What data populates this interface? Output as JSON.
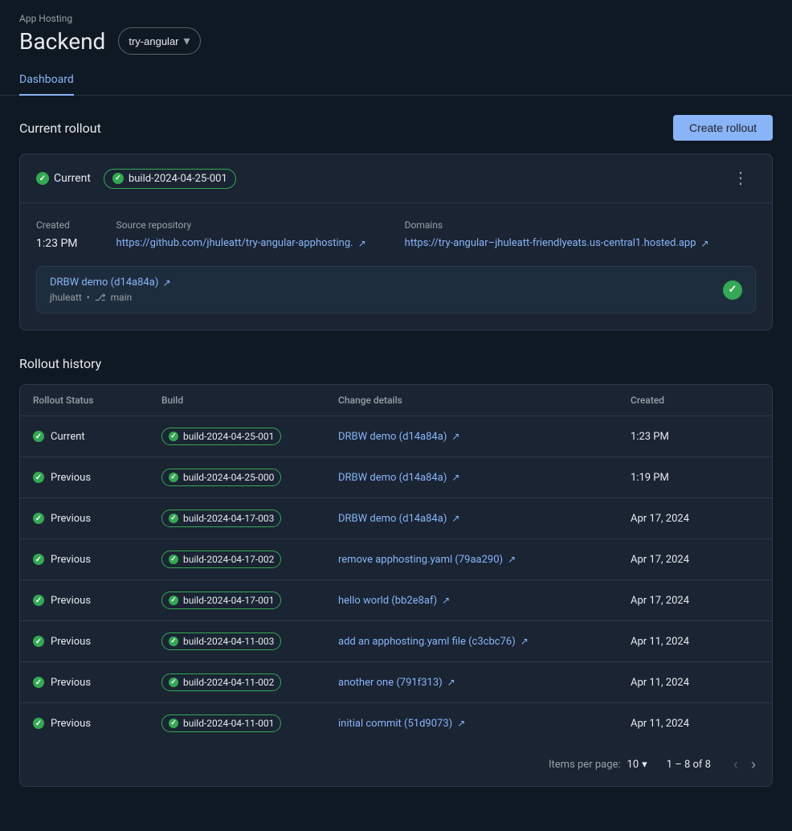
{
  "header": {
    "app_hosting_label": "App Hosting",
    "backend_title": "Backend",
    "branch_selector": {
      "value": "try-angular",
      "icon": "chevron-down"
    },
    "tabs": [
      {
        "id": "dashboard",
        "label": "Dashboard",
        "active": true
      }
    ]
  },
  "current_rollout": {
    "section_title": "Current rollout",
    "create_button_label": "Create rollout",
    "status": "Current",
    "build_id": "build-2024-04-25-001",
    "more_icon": "⋮",
    "created_label": "Created",
    "created_value": "1:23 PM",
    "source_repo_label": "Source repository",
    "source_repo_url": "https://github.com/jhuleatt/try-angular-apphosting",
    "source_repo_display": "https://github.com/jhuleatt/try-angular-apphosting.",
    "domains_label": "Domains",
    "domains_url": "https://try-angular–jhuleatt-friendlyeats.us-central1.hosted.app",
    "domains_display": "https://try-angular–jhuleatt-friendlyeats.us-central1.hosted.app",
    "commit": {
      "title": "DRBW demo (d14a84a)",
      "link": "https://github.com/jhuleatt/try-angular-apphosting/commit/d14a84a",
      "author": "jhuleatt",
      "branch": "main"
    }
  },
  "rollout_history": {
    "section_title": "Rollout history",
    "table": {
      "columns": [
        "Rollout Status",
        "Build",
        "Change details",
        "Created"
      ],
      "rows": [
        {
          "status": "Current",
          "build": "build-2024-04-25-001",
          "change": "DRBW demo (d14a84a)",
          "change_url": "#",
          "created": "1:23 PM"
        },
        {
          "status": "Previous",
          "build": "build-2024-04-25-000",
          "change": "DRBW demo (d14a84a)",
          "change_url": "#",
          "created": "1:19 PM"
        },
        {
          "status": "Previous",
          "build": "build-2024-04-17-003",
          "change": "DRBW demo (d14a84a)",
          "change_url": "#",
          "created": "Apr 17, 2024"
        },
        {
          "status": "Previous",
          "build": "build-2024-04-17-002",
          "change": "remove apphosting.yaml (79aa290)",
          "change_url": "#",
          "created": "Apr 17, 2024"
        },
        {
          "status": "Previous",
          "build": "build-2024-04-17-001",
          "change": "hello world (bb2e8af)",
          "change_url": "#",
          "created": "Apr 17, 2024"
        },
        {
          "status": "Previous",
          "build": "build-2024-04-11-003",
          "change": "add an apphosting.yaml file (c3cbc76)",
          "change_url": "#",
          "created": "Apr 11, 2024"
        },
        {
          "status": "Previous",
          "build": "build-2024-04-11-002",
          "change": "another one (791f313)",
          "change_url": "#",
          "created": "Apr 11, 2024"
        },
        {
          "status": "Previous",
          "build": "build-2024-04-11-001",
          "change": "initial commit (51d9073)",
          "change_url": "#",
          "created": "Apr 11, 2024"
        }
      ]
    },
    "pagination": {
      "items_per_page_label": "Items per page:",
      "items_per_page_value": "10",
      "page_range": "1 – 8 of 8"
    }
  }
}
